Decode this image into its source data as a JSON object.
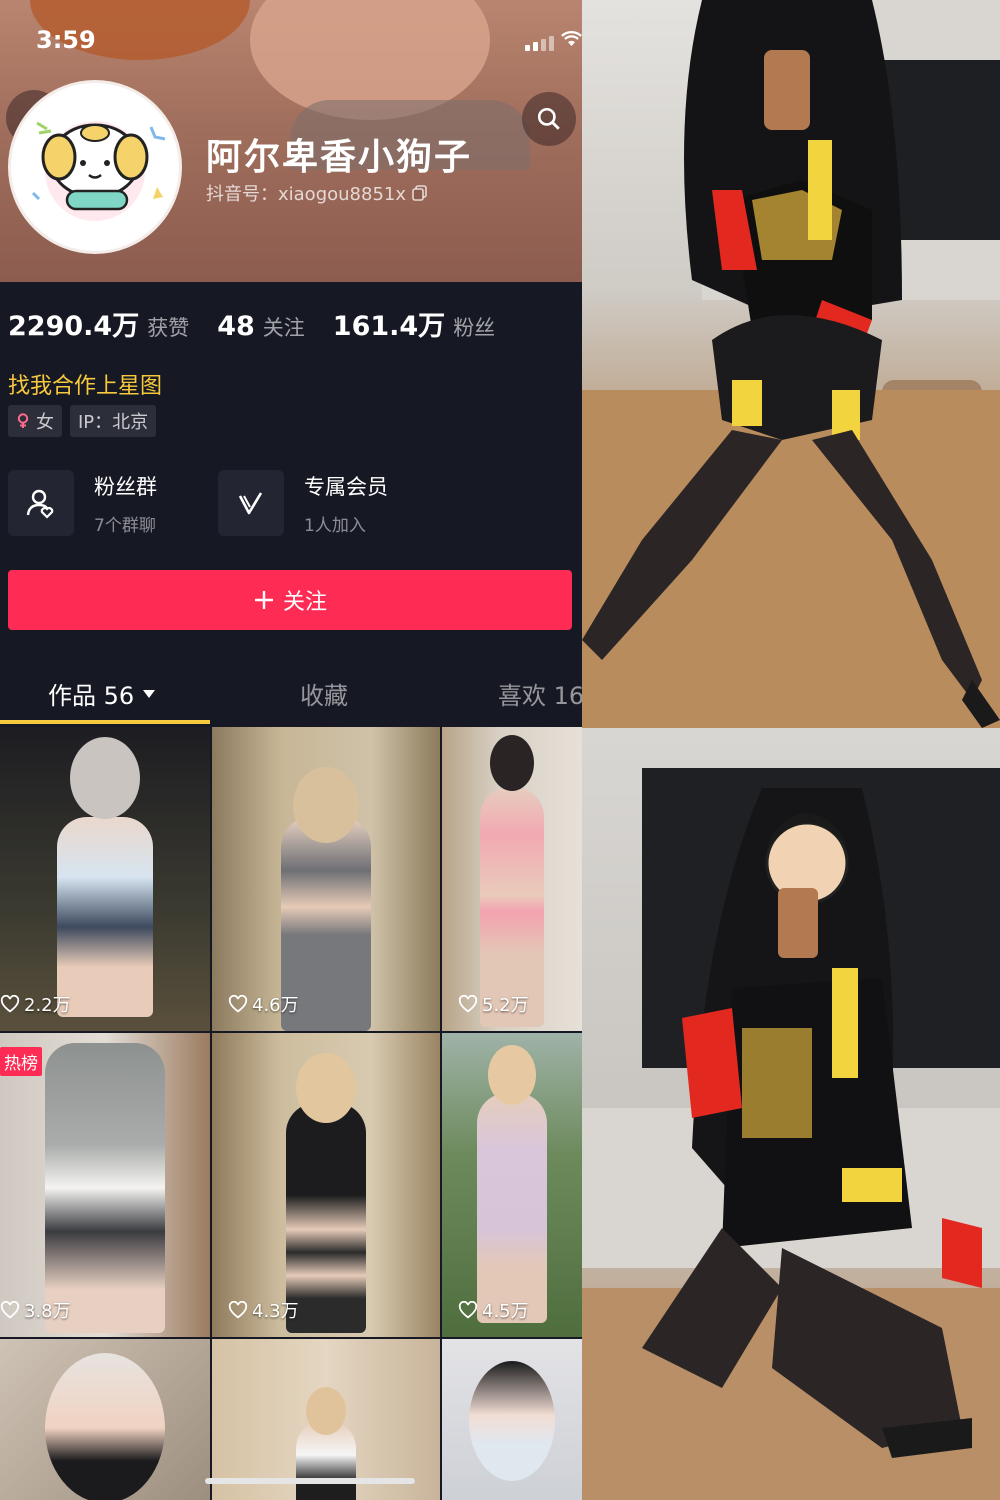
{
  "statusbar": {
    "time": "3:59"
  },
  "profile": {
    "name": "阿尔卑香小狗子",
    "douyin_id": "抖音号：xiaogou8851x"
  },
  "stats": [
    {
      "value": "2290.4万",
      "label": "获赞"
    },
    {
      "value": "48",
      "label": "关注"
    },
    {
      "value": "161.4万",
      "label": "粉丝"
    }
  ],
  "bio": "找我合作上星图",
  "tags": {
    "gender": "女",
    "ip": "IP：北京"
  },
  "features": [
    {
      "title": "粉丝群",
      "sub": "7个群聊"
    },
    {
      "title": "专属会员",
      "sub": "1人加入"
    }
  ],
  "follow_button": "关注",
  "tabs": [
    {
      "label": "作品 56"
    },
    {
      "label": "收藏"
    },
    {
      "label": "喜欢 16"
    }
  ],
  "videos": [
    {
      "likes": "2.2万"
    },
    {
      "likes": "4.6万"
    },
    {
      "likes": "5.2万"
    },
    {
      "likes": "3.8万",
      "badge": "热榜"
    },
    {
      "likes": "4.3万"
    },
    {
      "likes": "4.5万"
    },
    {
      "likes": ""
    },
    {
      "likes": ""
    },
    {
      "likes": ""
    }
  ],
  "colors": {
    "accent": "#fe2c55",
    "highlight": "#f7c93d",
    "background": "#161823"
  }
}
